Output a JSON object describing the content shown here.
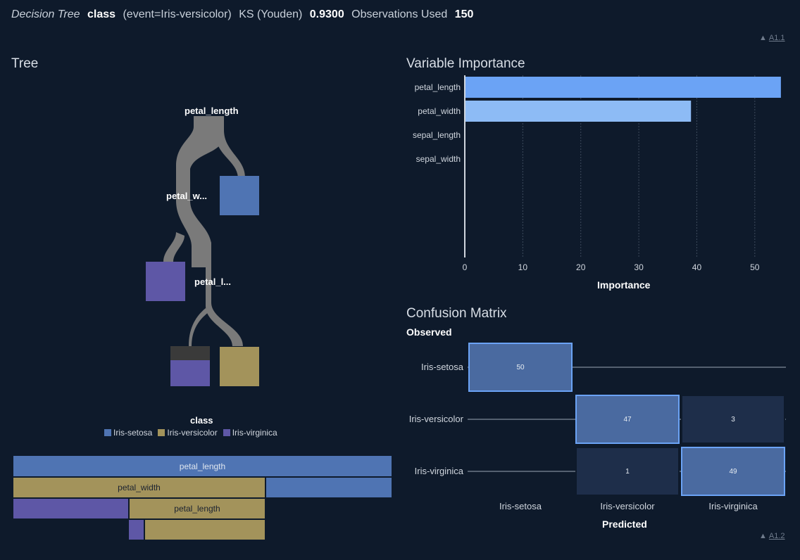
{
  "header": {
    "model": "Decision Tree",
    "target": "class",
    "event": "(event=Iris-versicolor)",
    "ks_label": "KS (Youden)",
    "ks_value": "0.9300",
    "obs_label": "Observations Used",
    "obs_value": "150"
  },
  "annotations": {
    "a1": "A1.1",
    "a2": "A1.2"
  },
  "tree": {
    "title": "Tree",
    "nodes": {
      "root": "petal_length",
      "n2": "petal_w...",
      "n3": "petal_l..."
    },
    "legend": {
      "title": "class",
      "items": [
        {
          "label": "Iris-setosa",
          "color": "#4f74b3"
        },
        {
          "label": "Iris-versicolor",
          "color": "#a3935b"
        },
        {
          "label": "Iris-virginica",
          "color": "#5e57a6"
        }
      ]
    },
    "icicle": {
      "r1": "petal_length",
      "r2": "petal_width",
      "r3": "petal_length"
    }
  },
  "variable_importance": {
    "title": "Variable Importance",
    "chart_data": {
      "type": "bar",
      "orientation": "horizontal",
      "categories": [
        "petal_length",
        "petal_width",
        "sepal_length",
        "sepal_width"
      ],
      "values": [
        54.5,
        39,
        0,
        0
      ],
      "xlabel": "Importance",
      "xticks": [
        0,
        10,
        20,
        30,
        40,
        50
      ],
      "xlim": [
        0,
        55
      ],
      "colors": [
        "#6ba3f5",
        "#8dbbf5",
        "#8dbbf5",
        "#8dbbf5"
      ],
      "grid": true
    }
  },
  "confusion_matrix": {
    "title": "Confusion Matrix",
    "observed_label": "Observed",
    "predicted_label": "Predicted",
    "rows": [
      "Iris-setosa",
      "Iris-versicolor",
      "Iris-virginica"
    ],
    "cols": [
      "Iris-setosa",
      "Iris-versicolor",
      "Iris-virginica"
    ],
    "cells": [
      {
        "row": 0,
        "col": 0,
        "value": "50",
        "correct": true
      },
      {
        "row": 1,
        "col": 1,
        "value": "47",
        "correct": true
      },
      {
        "row": 1,
        "col": 2,
        "value": "3",
        "correct": false
      },
      {
        "row": 2,
        "col": 1,
        "value": "1",
        "correct": false
      },
      {
        "row": 2,
        "col": 2,
        "value": "49",
        "correct": true
      }
    ]
  }
}
